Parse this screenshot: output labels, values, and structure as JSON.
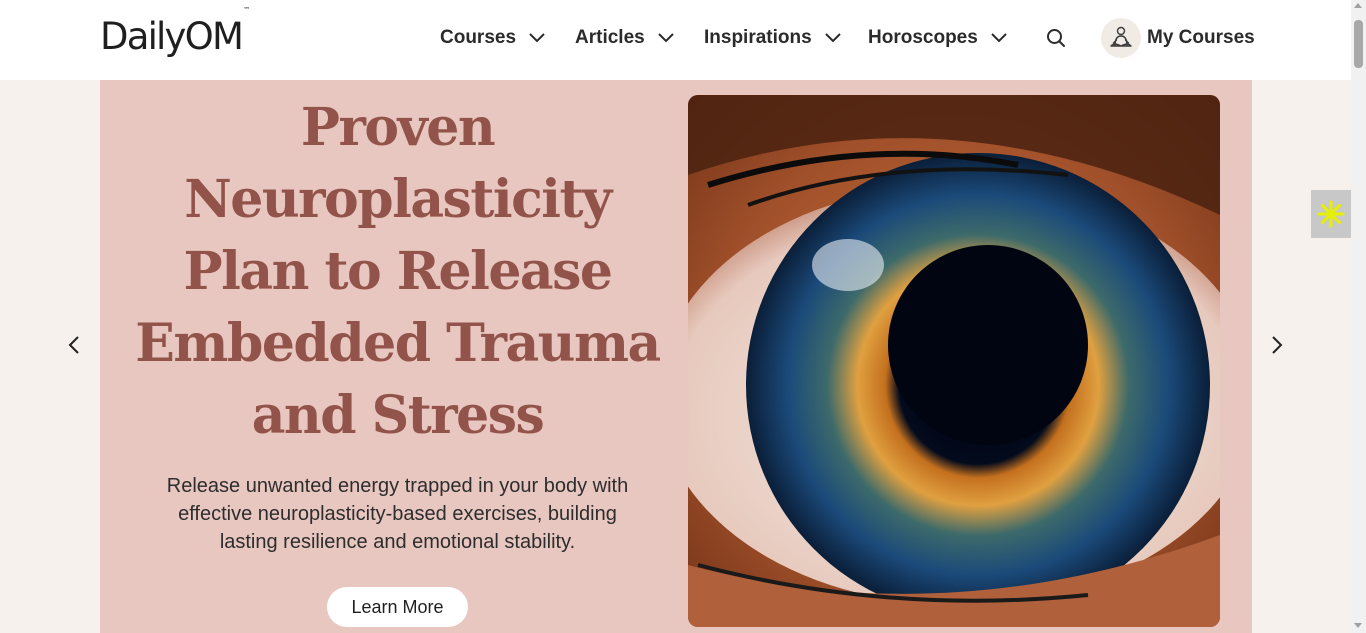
{
  "header": {
    "logo_text": "DailyOM",
    "logo_tm": "™",
    "nav": [
      {
        "label": "Courses"
      },
      {
        "label": "Articles"
      },
      {
        "label": "Inspirations"
      },
      {
        "label": "Horoscopes"
      }
    ],
    "search_icon": "search-icon",
    "my_courses_label": "My Courses",
    "avatar_icon": "meditation-person-icon"
  },
  "hero": {
    "title_lines": [
      "Proven",
      "Neuroplasticity",
      "Plan to Release",
      "Embedded Trauma",
      "and Stress"
    ],
    "subtitle_lines": [
      "Release unwanted energy trapped in your body with",
      "effective neuroplasticity-based exercises, building",
      "lasting resilience and emotional stability."
    ],
    "cta_label": "Learn More",
    "image_icon": "eye-closeup-image"
  },
  "carousel": {
    "prev_icon": "chevron-left-icon",
    "next_icon": "chevron-right-icon"
  },
  "widget": {
    "icon": "accessibility-burst-icon"
  },
  "colors": {
    "hero_bg": "#e8c7c0",
    "title": "#92534a",
    "page_bg": "#f6f1ed",
    "widget_bg": "#c8c8c8",
    "widget_icon": "#e6f000"
  }
}
